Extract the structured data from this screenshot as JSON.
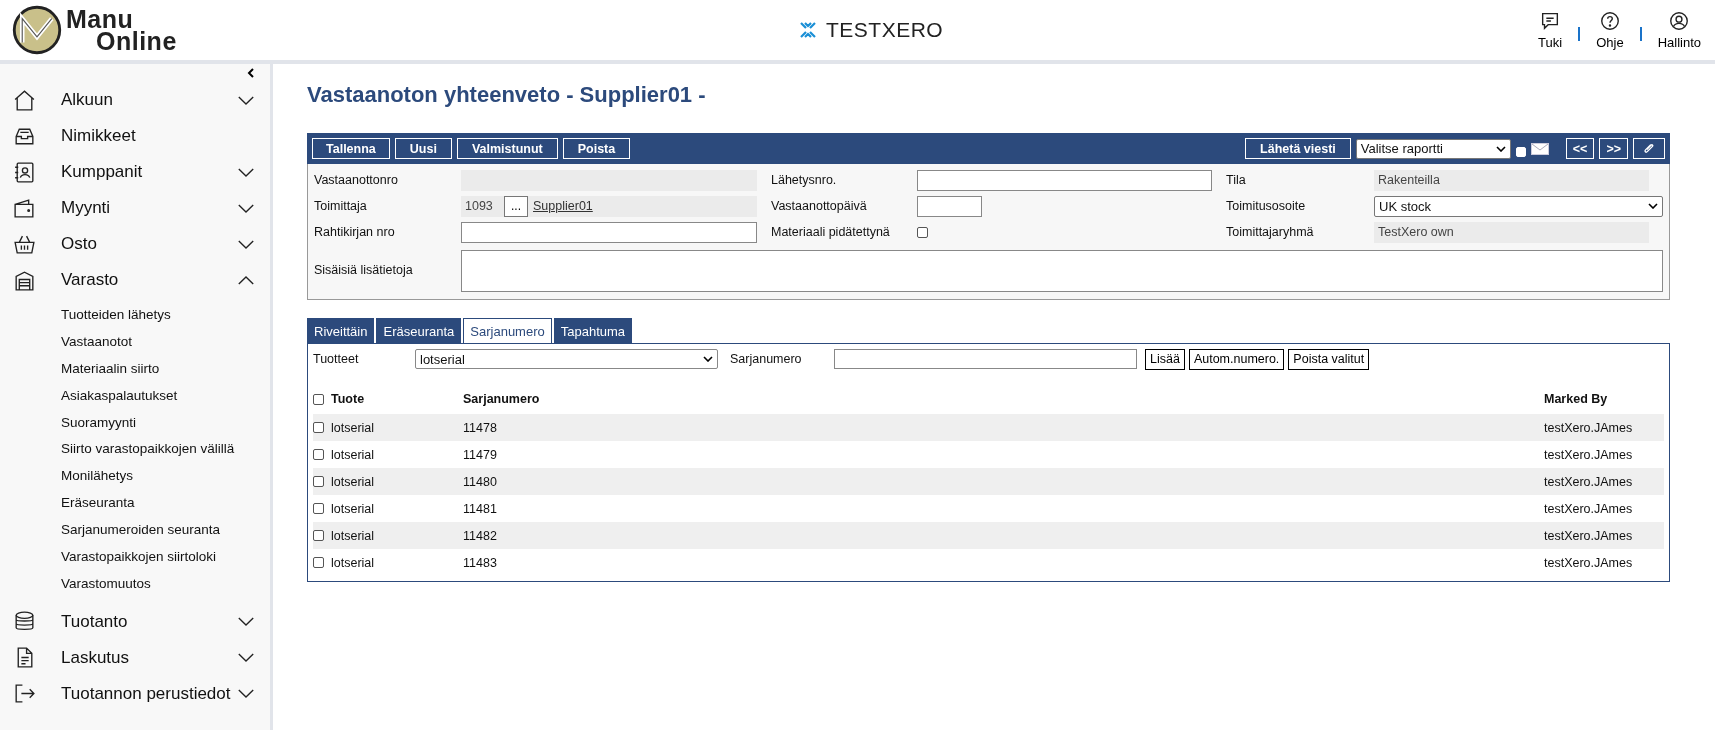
{
  "header": {
    "logo": [
      "Manu",
      "Online"
    ],
    "company": "TESTXERO",
    "actions": [
      {
        "label": "Tuki"
      },
      {
        "label": "Ohje"
      },
      {
        "label": "Hallinto"
      }
    ]
  },
  "sidebar": {
    "items": [
      {
        "label": "Alkuun",
        "kind": "menu",
        "expanded": false
      },
      {
        "label": "Nimikkeet",
        "kind": "link"
      },
      {
        "label": "Kumppanit",
        "kind": "menu",
        "expanded": false
      },
      {
        "label": "Myynti",
        "kind": "menu",
        "expanded": false
      },
      {
        "label": "Osto",
        "kind": "menu",
        "expanded": false
      },
      {
        "label": "Varasto",
        "kind": "menu",
        "expanded": true,
        "children": [
          {
            "label": "Tuotteiden lähetys"
          },
          {
            "label": "Vastaanotot"
          },
          {
            "label": "Materiaalin siirto"
          },
          {
            "label": "Asiakaspalautukset"
          },
          {
            "label": "Suoramyynti"
          },
          {
            "label": "Siirto varastopaikkojen välillä"
          },
          {
            "label": "Monilähetys"
          },
          {
            "label": "Eräseuranta"
          },
          {
            "label": "Sarjanumeroiden seuranta"
          },
          {
            "label": "Varastopaikkojen siirtoloki"
          },
          {
            "label": "Varastomuutos"
          }
        ]
      },
      {
        "label": "Tuotanto",
        "kind": "menu",
        "expanded": false
      },
      {
        "label": "Laskutus",
        "kind": "menu",
        "expanded": false
      },
      {
        "label": "Tuotannon perustiedot",
        "kind": "menu",
        "expanded": false
      }
    ]
  },
  "page": {
    "title": "Vastaanoton yhteenveto - Supplier01 -"
  },
  "toolbar": {
    "buttons": [
      "Tallenna",
      "Uusi",
      "Valmistunut",
      "Poista"
    ],
    "send_button": "Lähetä viesti",
    "report_select": "Valitse raportti",
    "email_checked": false,
    "nav_buttons": [
      "<<",
      ">>"
    ]
  },
  "form": {
    "fields": [
      {
        "label": "Vastaanottonro",
        "kind": "readonly"
      },
      {
        "label": "Lähetysnro.",
        "kind": "input"
      },
      {
        "label": "Tila",
        "kind": "readonly",
        "value": "Rakenteilla"
      },
      {
        "label": "Toimittaja",
        "kind": "lookup",
        "code": "1093",
        "button": "...",
        "link": "Supplier01"
      },
      {
        "label": "Vastaanottopäivä",
        "kind": "date"
      },
      {
        "label": "Toimitusosoite",
        "kind": "select",
        "value": "UK stock"
      },
      {
        "label": "Rahtikirjan nro",
        "kind": "input"
      },
      {
        "label": "Materiaali pidätettynä",
        "kind": "checkbox",
        "checked": false
      },
      {
        "label": "Toimittajaryhmä",
        "kind": "readonly",
        "value": "TestXero own"
      },
      {
        "label": "Sisäisiä lisätietoja",
        "kind": "textarea"
      }
    ]
  },
  "tabs": [
    {
      "label": "Riveittäin",
      "selected": false
    },
    {
      "label": "Eräseuranta",
      "selected": false
    },
    {
      "label": "Sarjanumero",
      "selected": true
    },
    {
      "label": "Tapahtuma",
      "selected": false
    }
  ],
  "serials": {
    "product_label": "Tuotteet",
    "product_select": "lotserial",
    "serial_label": "Sarjanumero",
    "buttons": [
      "Lisää",
      "Autom.numero.",
      "Poista valitut"
    ],
    "columns": [
      "Tuote",
      "Sarjanumero",
      "Marked By"
    ],
    "all_checked": false,
    "rows": [
      {
        "product": "lotserial",
        "serial": "11478",
        "marked_by": "testXero.JAmes",
        "checked": false
      },
      {
        "product": "lotserial",
        "serial": "11479",
        "marked_by": "testXero.JAmes",
        "checked": false
      },
      {
        "product": "lotserial",
        "serial": "11480",
        "marked_by": "testXero.JAmes",
        "checked": false
      },
      {
        "product": "lotserial",
        "serial": "11481",
        "marked_by": "testXero.JAmes",
        "checked": false
      },
      {
        "product": "lotserial",
        "serial": "11482",
        "marked_by": "testXero.JAmes",
        "checked": false
      },
      {
        "product": "lotserial",
        "serial": "11483",
        "marked_by": "testXero.JAmes",
        "checked": false
      }
    ]
  }
}
